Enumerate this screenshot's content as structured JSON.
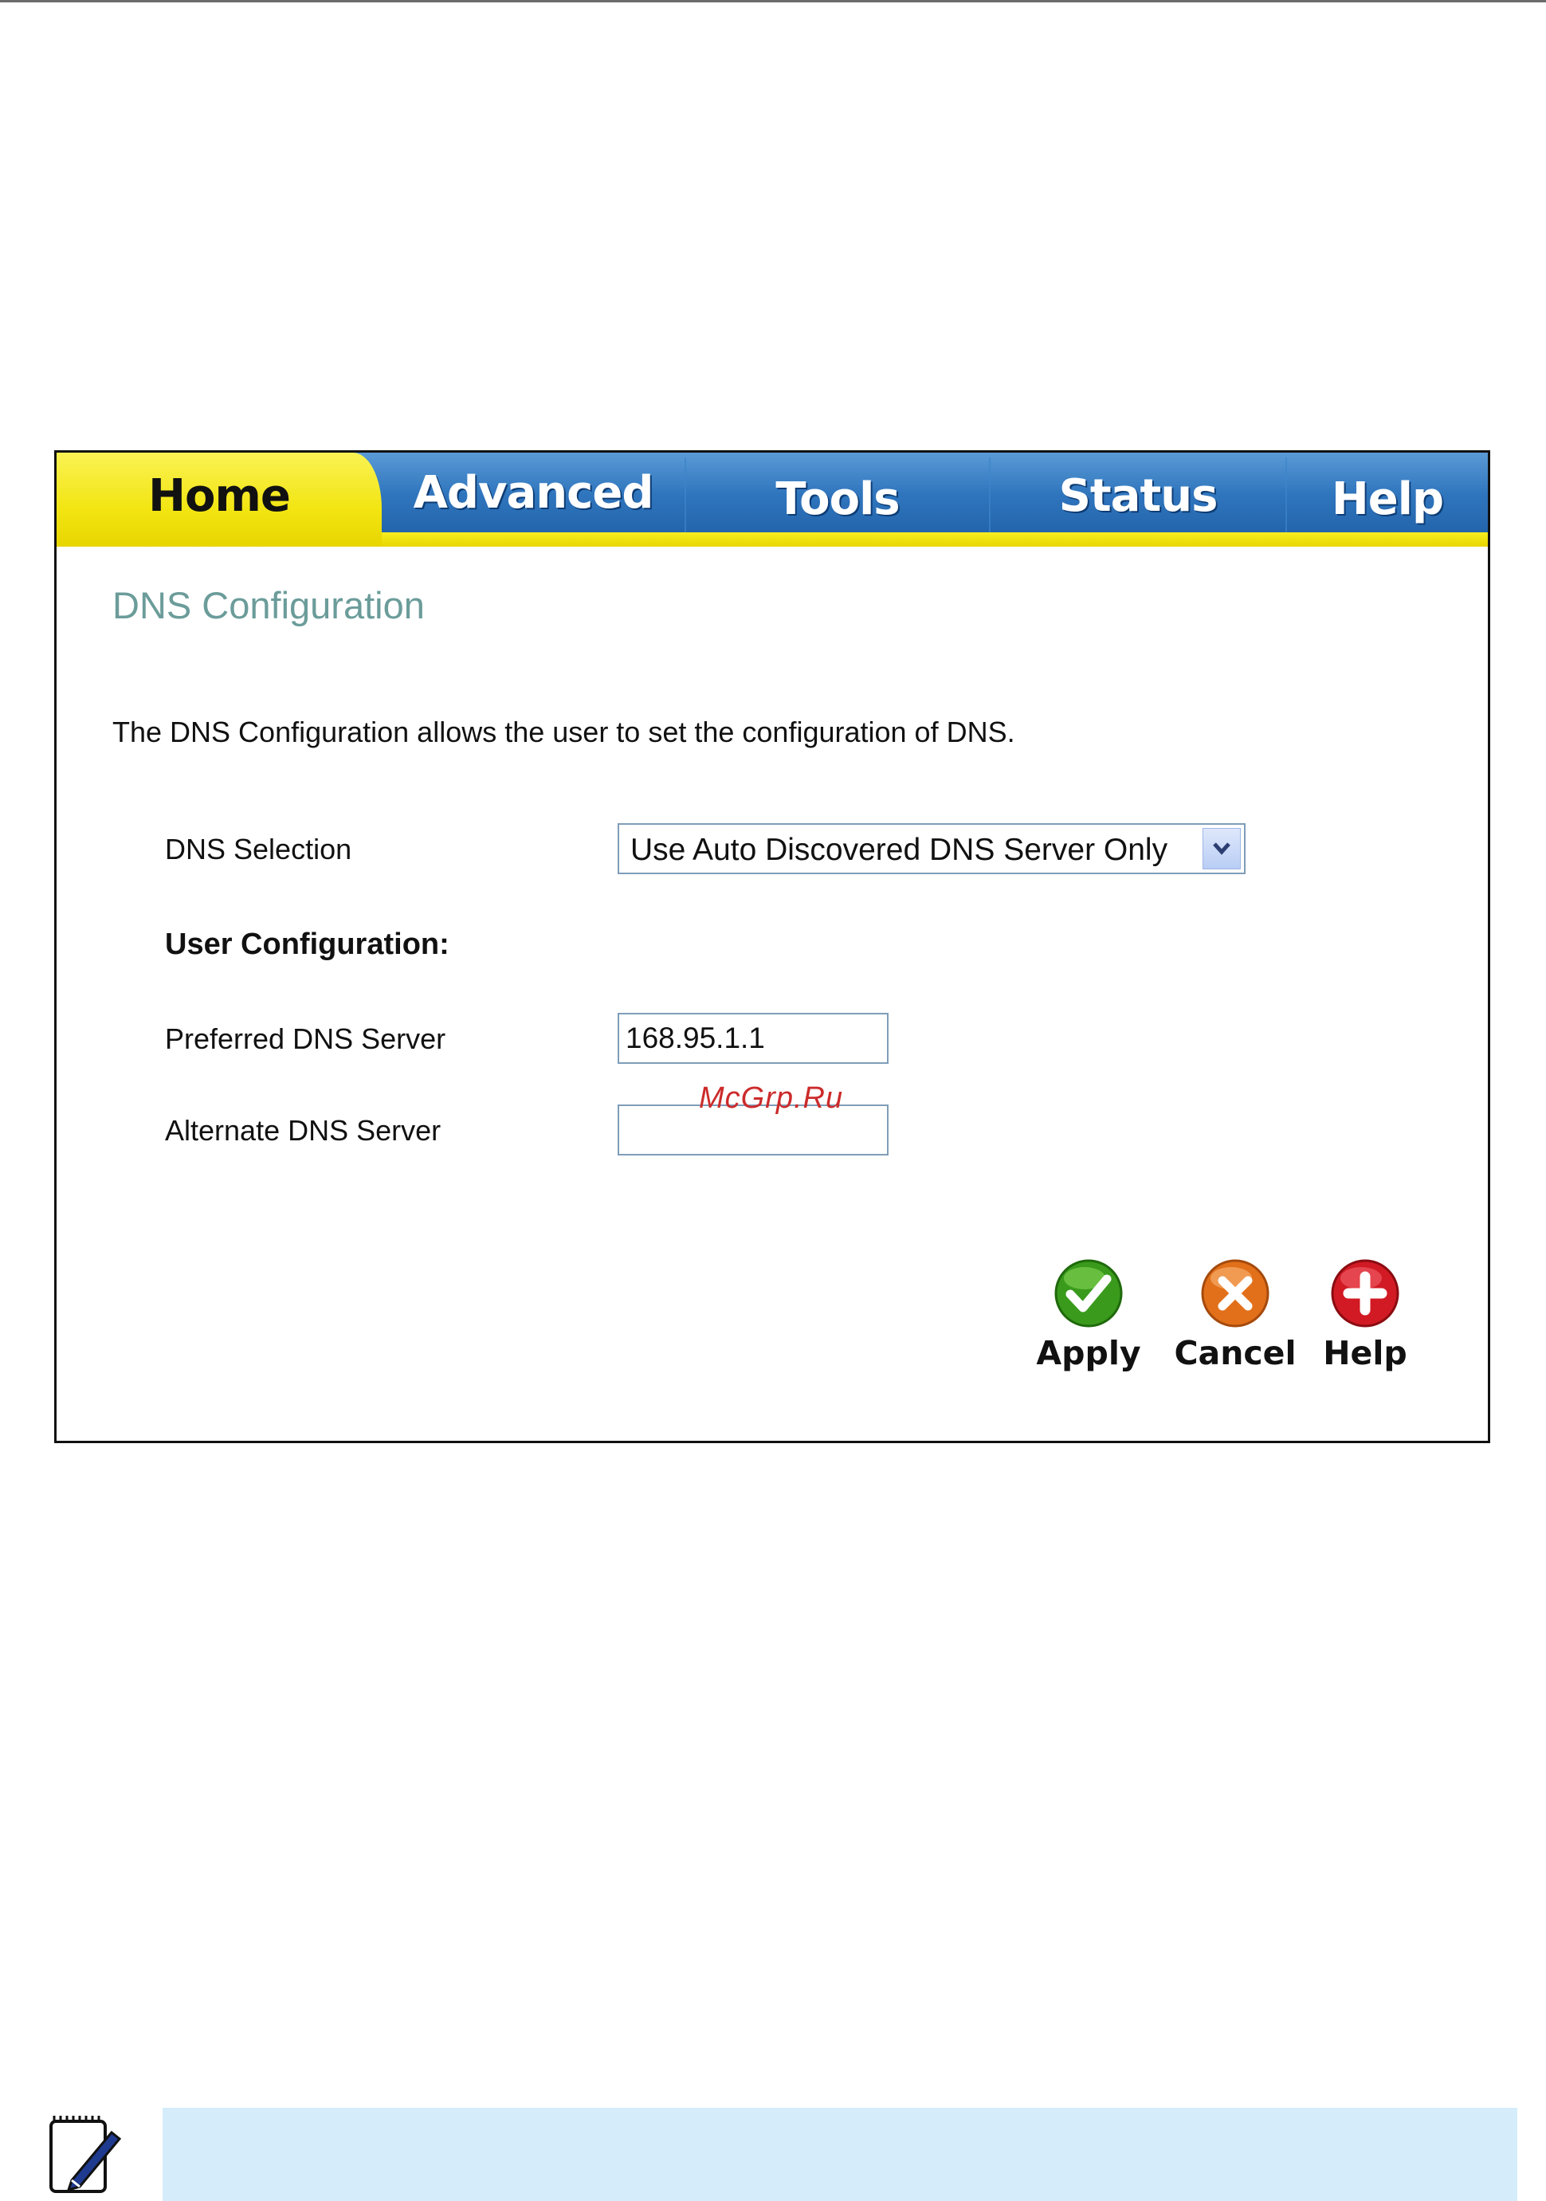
{
  "tabs": [
    {
      "label": "Home",
      "active": true
    },
    {
      "label": "Advanced",
      "active": false
    },
    {
      "label": "Tools",
      "active": false
    },
    {
      "label": "Status",
      "active": false
    },
    {
      "label": "Help",
      "active": false
    }
  ],
  "page": {
    "title": "DNS Configuration",
    "intro": "The DNS Configuration allows the user to set the configuration of DNS."
  },
  "form": {
    "dns_selection_label": "DNS Selection",
    "dns_selection_value": "Use Auto Discovered DNS Server Only",
    "user_config_heading": "User Configuration:",
    "preferred_label": "Preferred DNS Server",
    "preferred_value": "168.95.1.1",
    "alternate_label": "Alternate DNS Server",
    "alternate_value": ""
  },
  "actions": {
    "apply": "Apply",
    "cancel": "Cancel",
    "help": "Help"
  },
  "watermark": "McGrp.Ru",
  "icons": {
    "apply": "checkmark-icon",
    "cancel": "x-icon",
    "help": "plus-icon",
    "dropdown": "chevron-down-icon",
    "note": "note-pen-icon"
  },
  "colors": {
    "tab_active": "#f2e512",
    "tab_bar": "#2f75bd",
    "title": "#6b9c9a",
    "apply": "#3a9a1c",
    "cancel": "#e2701a",
    "help": "#d11a24",
    "note_bg": "#d5edfb"
  }
}
